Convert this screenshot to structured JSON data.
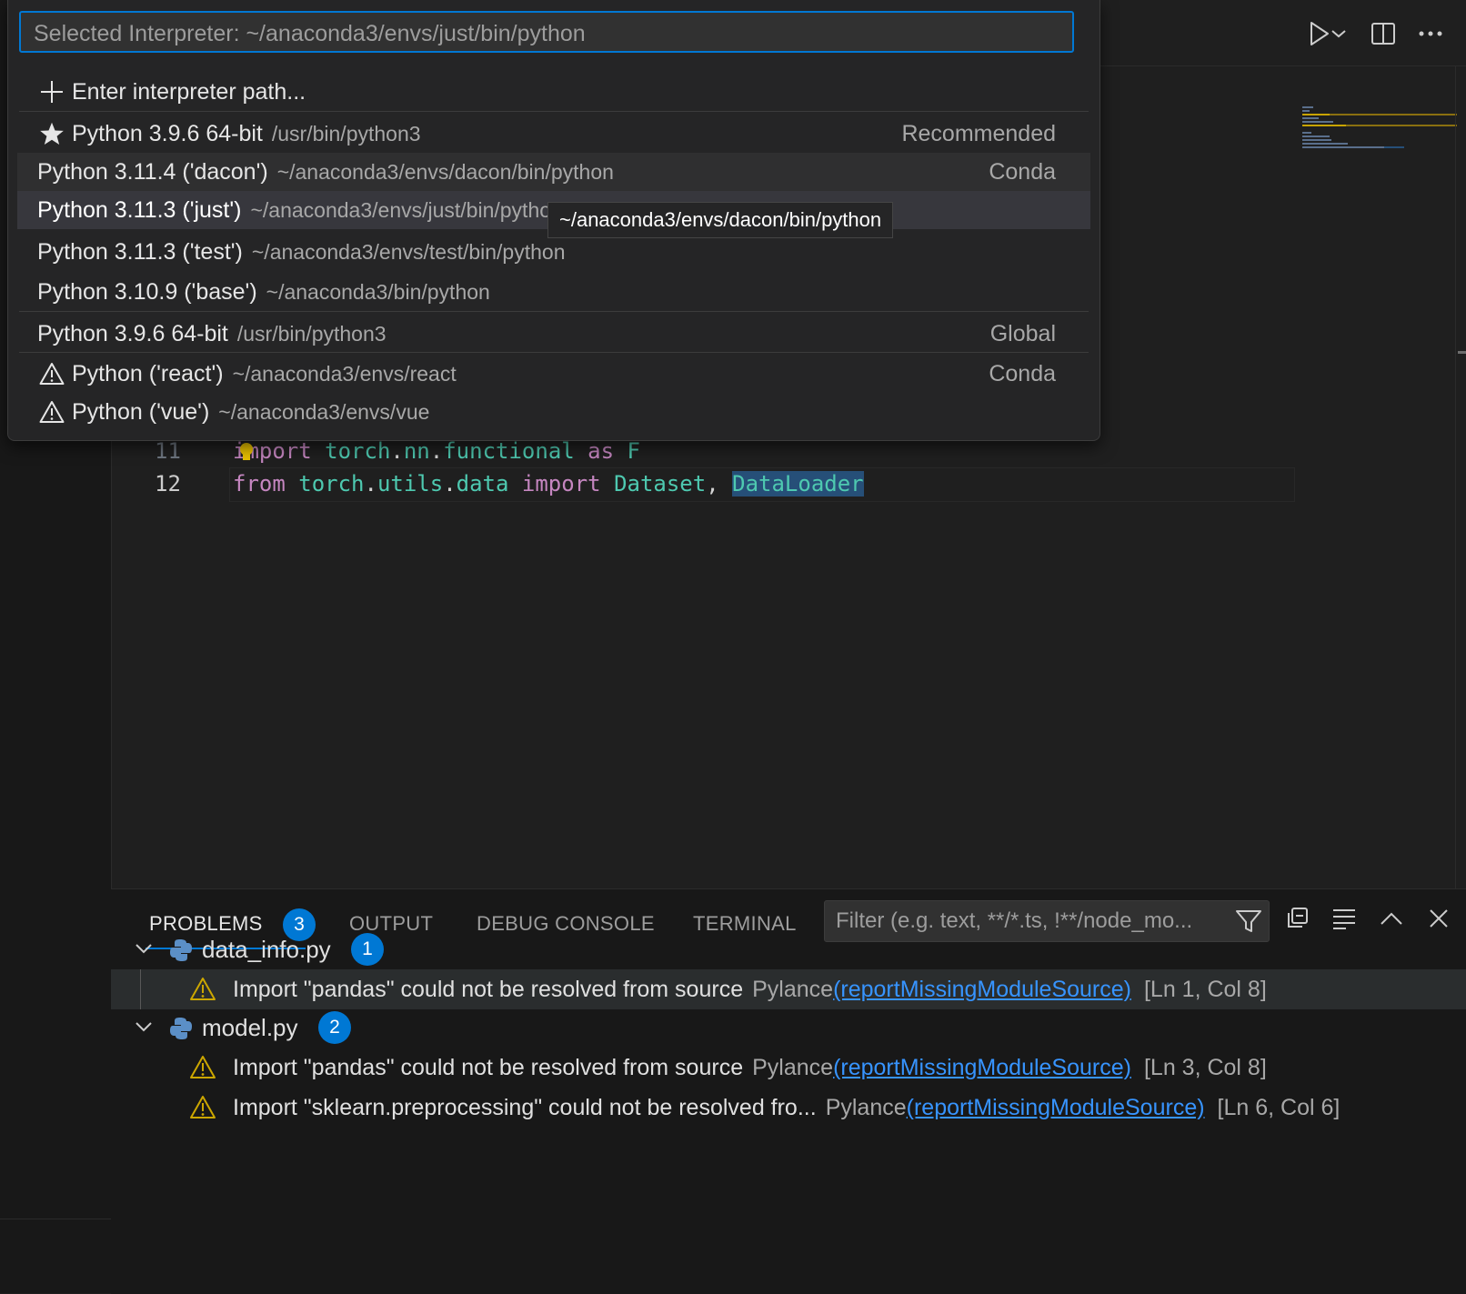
{
  "quick_pick": {
    "input_value": "Selected Interpreter: ~/anaconda3/envs/just/bin/python",
    "enter_path_label": "Enter interpreter path...",
    "items": [
      {
        "label": "Python 3.9.6 64-bit",
        "description": "/usr/bin/python3",
        "detail": "Recommended",
        "icon": "star-icon"
      },
      {
        "label": "Python 3.11.4 ('dacon')",
        "description": "~/anaconda3/envs/dacon/bin/python",
        "detail": "Conda",
        "icon": ""
      },
      {
        "label": "Python 3.11.3 ('just')",
        "description": "~/anaconda3/envs/just/bin/python",
        "detail": "",
        "icon": ""
      },
      {
        "label": "Python 3.11.3 ('test')",
        "description": "~/anaconda3/envs/test/bin/python",
        "detail": "",
        "icon": ""
      },
      {
        "label": "Python 3.10.9 ('base')",
        "description": "~/anaconda3/bin/python",
        "detail": "",
        "icon": ""
      },
      {
        "label": "Python 3.9.6 64-bit",
        "description": "/usr/bin/python3",
        "detail": "Global",
        "icon": ""
      },
      {
        "label": "Python ('react')",
        "description": "~/anaconda3/envs/react",
        "detail": "Conda",
        "icon": "warning-icon"
      },
      {
        "label": "Python ('vue')",
        "description": "~/anaconda3/envs/vue",
        "detail": "",
        "icon": "warning-icon"
      }
    ],
    "tooltip": "~/anaconda3/envs/dacon/bin/python"
  },
  "editor": {
    "lines": [
      {
        "number": "11",
        "tokens": [
          "import",
          "torch",
          ".",
          "nn",
          ".",
          "functional",
          "as",
          "F"
        ]
      },
      {
        "number": "12",
        "tokens": [
          "from",
          "torch",
          ".",
          "utils",
          ".",
          "data",
          "import",
          "Dataset",
          ",",
          "DataLoader"
        ]
      }
    ]
  },
  "panel": {
    "tabs": [
      "PROBLEMS",
      "OUTPUT",
      "DEBUG CONSOLE",
      "TERMINAL"
    ],
    "problems_count": "3",
    "filter_placeholder": "Filter (e.g. text, **/*.ts, !**/node_mo...",
    "files": [
      {
        "name": "data_info.py",
        "count": "1",
        "problems": [
          {
            "message": "Import \"pandas\" could not be resolved from source",
            "source": "Pylance",
            "code": "(reportMissingModuleSource)",
            "location": "[Ln 1, Col 8]"
          }
        ]
      },
      {
        "name": "model.py",
        "count": "2",
        "problems": [
          {
            "message": "Import \"pandas\" could not be resolved from source",
            "source": "Pylance",
            "code": "(reportMissingModuleSource)",
            "location": "[Ln 3, Col 8]"
          },
          {
            "message": "Import \"sklearn.preprocessing\" could not be resolved fro...",
            "source": "Pylance",
            "code": "(reportMissingModuleSource)",
            "location": "[Ln 6, Col 6]"
          }
        ]
      }
    ]
  },
  "colors": {
    "accent": "#0078d4",
    "warning": "#cca700",
    "link": "#3794ff"
  }
}
